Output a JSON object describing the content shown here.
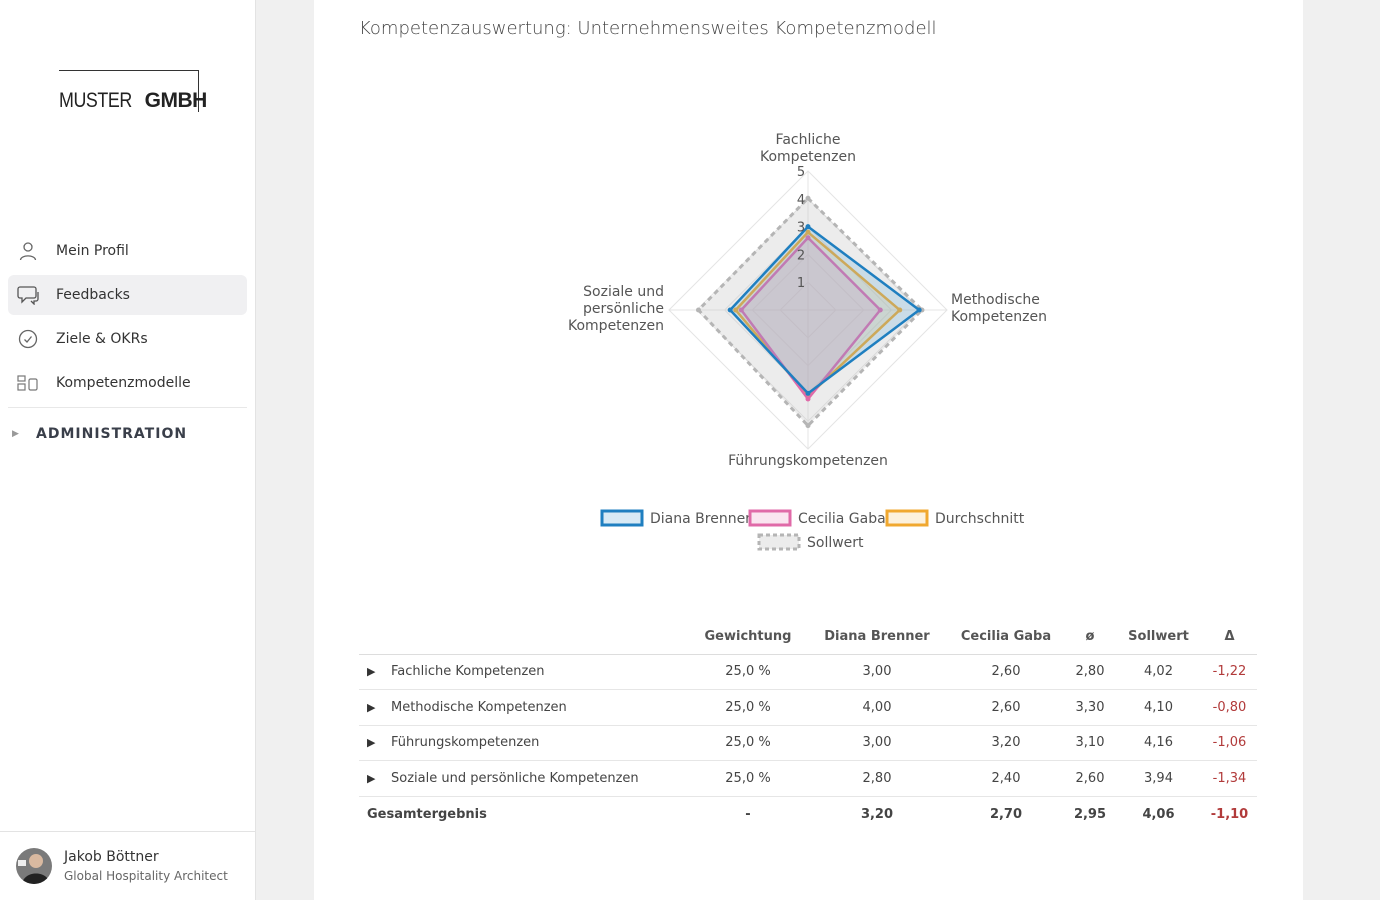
{
  "brand": {
    "logo_thin": "MUSTER",
    "logo_bold": "GMBH"
  },
  "nav": {
    "items": [
      {
        "label": "Mein Profil",
        "icon": "user-icon"
      },
      {
        "label": "Feedbacks",
        "icon": "chat-icon",
        "active": true
      },
      {
        "label": "Ziele & OKRs",
        "icon": "check-circle-icon"
      },
      {
        "label": "Kompetenzmodelle",
        "icon": "blocks-icon"
      }
    ],
    "admin_label": "ADMINISTRATION"
  },
  "user": {
    "name": "Jakob Böttner",
    "role": "Global Hospitality Architect"
  },
  "page": {
    "title": "Kompetenzauswertung: Unternehmensweites Kompetenzmodell"
  },
  "chart_data": {
    "type": "radar",
    "axes": [
      [
        "Fachliche",
        "Kompetenzen"
      ],
      [
        "Methodische",
        "Kompetenzen"
      ],
      [
        "Führungskompetenzen"
      ],
      [
        "Soziale und",
        "persönliche",
        "Kompetenzen"
      ]
    ],
    "scale": {
      "min": 0,
      "max": 5,
      "ticks": [
        1,
        2,
        3,
        4,
        5
      ]
    },
    "series": [
      {
        "name": "Diana Brenner",
        "values": [
          3.0,
          4.0,
          3.0,
          2.8
        ],
        "color": "#1f7fc0",
        "fill": "rgba(100,170,215,0.25)"
      },
      {
        "name": "Cecilia Gaba",
        "values": [
          2.6,
          2.6,
          3.2,
          2.4
        ],
        "color": "#e06aa8",
        "fill": "rgba(235,150,195,0.25)"
      },
      {
        "name": "Durchschnitt",
        "values": [
          2.8,
          3.3,
          3.1,
          2.6
        ],
        "color": "#f0a830",
        "fill": "rgba(245,200,120,0.25)"
      },
      {
        "name": "Sollwert",
        "values": [
          4.02,
          4.1,
          4.16,
          3.94
        ],
        "color": "#b5b5b5",
        "fill": "rgba(200,200,200,0.35)",
        "dashed": true
      }
    ],
    "legend": "bottom"
  },
  "table": {
    "headers": [
      "",
      "Gewichtung",
      "Diana Brenner",
      "Cecilia Gaba",
      "ø",
      "Sollwert",
      "Δ"
    ],
    "rows": [
      {
        "name": "Fachliche Kompetenzen",
        "weight": "25,0 %",
        "diana": "3,00",
        "cecilia": "2,60",
        "avg": "2,80",
        "soll": "4,02",
        "delta": "-1,22"
      },
      {
        "name": "Methodische Kompetenzen",
        "weight": "25,0 %",
        "diana": "4,00",
        "cecilia": "2,60",
        "avg": "3,30",
        "soll": "4,10",
        "delta": "-0,80"
      },
      {
        "name": "Führungskompetenzen",
        "weight": "25,0 %",
        "diana": "3,00",
        "cecilia": "3,20",
        "avg": "3,10",
        "soll": "4,16",
        "delta": "-1,06"
      },
      {
        "name": "Soziale und persönliche Kompetenzen",
        "weight": "25,0 %",
        "diana": "2,80",
        "cecilia": "2,40",
        "avg": "2,60",
        "soll": "3,94",
        "delta": "-1,34"
      }
    ],
    "total": {
      "name": "Gesamtergebnis",
      "weight": "-",
      "diana": "3,20",
      "cecilia": "2,70",
      "avg": "2,95",
      "soll": "4,06",
      "delta": "-1,10"
    }
  }
}
